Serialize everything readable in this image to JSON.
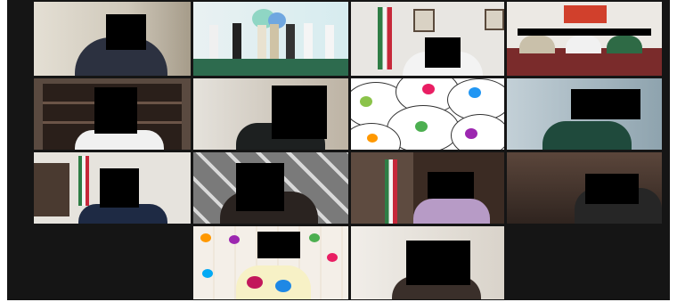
{
  "app": {
    "view": "gallery",
    "participant_count": 14,
    "active_speaker_tile": 1
  },
  "participants": [
    {
      "tile": 1,
      "video": "on",
      "name_visible": false
    },
    {
      "tile": 2,
      "video": "on",
      "name_visible": false
    },
    {
      "tile": 3,
      "video": "on",
      "name_visible": false
    },
    {
      "tile": 4,
      "video": "on",
      "name_visible": false
    },
    {
      "tile": 5,
      "video": "on",
      "name_visible": false
    },
    {
      "tile": 6,
      "video": "on",
      "name_visible": false
    },
    {
      "tile": 7,
      "video": "on",
      "name_visible": false
    },
    {
      "tile": 8,
      "video": "on",
      "name_visible": false
    },
    {
      "tile": 9,
      "video": "on",
      "name_visible": false
    },
    {
      "tile": 10,
      "video": "on",
      "name_visible": false
    },
    {
      "tile": 11,
      "video": "on",
      "name_visible": false
    },
    {
      "tile": 12,
      "video": "on",
      "name_visible": false
    },
    {
      "tile": 13,
      "video": "on",
      "name_visible": false
    },
    {
      "tile": 14,
      "video": "on",
      "name_visible": false
    }
  ],
  "colors": {
    "background": "#151515",
    "active_border": "#c9d35a",
    "redaction": "#000000"
  }
}
